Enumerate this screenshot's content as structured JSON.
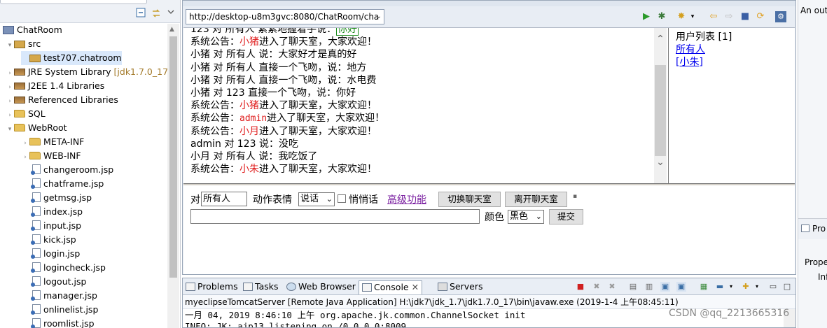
{
  "explorer": {
    "project": "ChatRoom",
    "items": [
      {
        "label": "src",
        "icon": "source-folder-icon"
      },
      {
        "label": "test707.chatroom",
        "icon": "package-icon"
      },
      {
        "label": "JRE System Library",
        "extra": "[jdk1.7.0_17]",
        "icon": "library-icon"
      },
      {
        "label": "J2EE 1.4 Libraries",
        "icon": "library-icon"
      },
      {
        "label": "Referenced Libraries",
        "icon": "library-icon"
      },
      {
        "label": "SQL",
        "icon": "folder-icon"
      },
      {
        "label": "WebRoot",
        "icon": "folder-icon"
      },
      {
        "label": "META-INF",
        "icon": "folder-icon"
      },
      {
        "label": "WEB-INF",
        "icon": "folder-icon"
      },
      {
        "label": "changeroom.jsp",
        "icon": "jsp-file-icon"
      },
      {
        "label": "chatframe.jsp",
        "icon": "jsp-file-icon"
      },
      {
        "label": "getmsg.jsp",
        "icon": "jsp-file-icon"
      },
      {
        "label": "index.jsp",
        "icon": "jsp-file-icon"
      },
      {
        "label": "input.jsp",
        "icon": "jsp-file-icon"
      },
      {
        "label": "kick.jsp",
        "icon": "jsp-file-icon"
      },
      {
        "label": "login.jsp",
        "icon": "jsp-file-icon"
      },
      {
        "label": "logincheck.jsp",
        "icon": "jsp-file-icon"
      },
      {
        "label": "logout.jsp",
        "icon": "jsp-file-icon"
      },
      {
        "label": "manager.jsp",
        "icon": "jsp-file-icon"
      },
      {
        "label": "onlinelist.jsp",
        "icon": "jsp-file-icon"
      },
      {
        "label": "roomlist.jsp",
        "icon": "jsp-file-icon"
      }
    ]
  },
  "browser": {
    "url": "http://desktop-u8m3gvc:8080/ChatRoom/cha"
  },
  "chat": {
    "partial_top": {
      "a": "123 对 所有人 紧紧地握着手说：",
      "b": "你好"
    },
    "l1": {
      "prefix": "系统公告：",
      "name": "小猪",
      "suffix": "进入了聊天室，大家欢迎！"
    },
    "l2": "小猪 对 所有人 说：大家好才是真的好",
    "l3": "小猪 对 所有人 直接一个飞吻，说：地方",
    "l4": "小猪 对 所有人 直接一个飞吻，说：水电费",
    "l5": "小猪 对 123 直接一个飞吻，说：你好",
    "l6": {
      "prefix": "系统公告：",
      "name": "小猪",
      "suffix": "进入了聊天室，大家欢迎！"
    },
    "l7": {
      "prefix": "系统公告：",
      "name": "admin",
      "suffix": "进入了聊天室，大家欢迎！"
    },
    "l8": {
      "prefix": "系统公告：",
      "name": "小月",
      "suffix": "进入了聊天室，大家欢迎！"
    },
    "l9": "admin 对 123 说：没吃",
    "l10": "小月 对 所有人 说：我吃饭了",
    "l11": {
      "prefix": "系统公告：",
      "name": "小朱",
      "suffix": "进入了聊天室，大家欢迎！"
    }
  },
  "userlist": {
    "title": "用户列表 [1]",
    "all": "所有人",
    "user": "[小朱]"
  },
  "controls": {
    "to_label": "对",
    "to_value": "所有人",
    "action_label": "动作表情",
    "action_value": "说话",
    "whisper_label": "悄悄话",
    "advanced_link": "高级功能",
    "switch_room": "切换聊天室",
    "leave_room": "离开聊天室",
    "color_label": "颜色",
    "color_value": "黑色",
    "submit": "提交"
  },
  "right_panel": {
    "outline_cut": "An out",
    "pro_cut": "Pro",
    "prope_cut": "Prope",
    "inf_cut": "Inf"
  },
  "console": {
    "tabs": [
      "Problems",
      "Tasks",
      "Web Browser",
      "Console",
      "Servers"
    ],
    "title": "myeclipseTomcatServer [Remote Java Application] H:\\jdk7\\jdk_1.7\\jdk1.7.0_17\\bin\\javaw.exe (2019-1-4 上午08:45:11)",
    "line1": "一月 04, 2019 8:46:10 上午 org.apache.jk.common.ChannelSocket init",
    "line2": "INFO: JK: ajp13 listening on /0.0.0.0:8009"
  },
  "watermark": "CSDN @qq_2213665316",
  "colors": {
    "system_name": "#e02020",
    "link": "#0000ee"
  }
}
